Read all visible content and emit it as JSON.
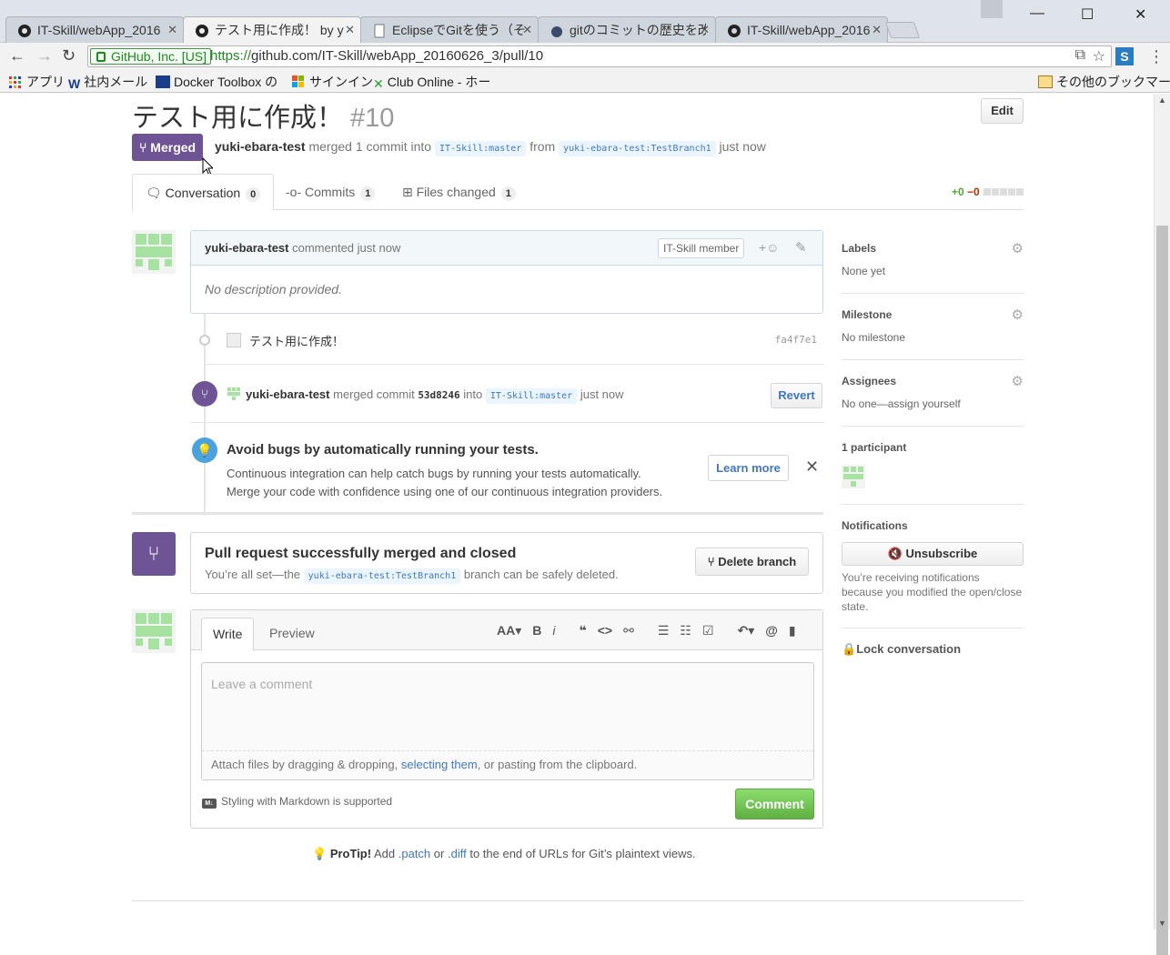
{
  "browser": {
    "tabs": [
      {
        "label": "IT-Skill/webApp_2016",
        "favicon": "github-icon"
      },
      {
        "label": "テスト用に作成！ by y",
        "favicon": "github-icon"
      },
      {
        "label": "EclipseでGitを使う（そ",
        "favicon": "page-icon"
      },
      {
        "label": "gitのコミットの歴史を改",
        "favicon": "site-icon"
      },
      {
        "label": "IT-Skill/webApp_2016",
        "favicon": "github-icon"
      }
    ],
    "secure_label": "GitHub, Inc. [US]",
    "url_protocol": "https://",
    "url_rest": "github.com/IT-Skill/webApp_20160626_3/pull/10",
    "bookmarks": [
      {
        "label": "アプリ"
      },
      {
        "label": "社内メール"
      },
      {
        "label": "Docker Toolbox の"
      },
      {
        "label": "サインイン"
      },
      {
        "label": "Club Online - ホー"
      }
    ],
    "other_bookmarks": "その他のブックマーク"
  },
  "pr": {
    "title": "テスト用に作成！",
    "number": "#10",
    "edit_label": "Edit",
    "state_label": "Merged",
    "author": "yuki-ebara-test",
    "merged_text": "merged 1 commit into",
    "base_ref": "IT-Skill:master",
    "from_text": "from",
    "head_ref": "yuki-ebara-test:TestBranch1",
    "time": "just now"
  },
  "tabs": [
    {
      "label": "Conversation",
      "count": "0"
    },
    {
      "label": "Commits",
      "count": "1"
    },
    {
      "label": "Files changed",
      "count": "1"
    }
  ],
  "diffstat": {
    "add": "+0",
    "del": "−0"
  },
  "comment": {
    "author": "yuki-ebara-test",
    "action": "commented just now",
    "badge": "IT-Skill member",
    "body": "No description provided."
  },
  "commit": {
    "message": "テスト用に作成！",
    "sha": "fa4f7e1"
  },
  "merge_event": {
    "author": "yuki-ebara-test",
    "text": "merged commit",
    "sha": "53d8246",
    "into": "into",
    "ref": "IT-Skill:master",
    "time": "just now",
    "revert_label": "Revert"
  },
  "ci": {
    "title": "Avoid bugs by automatically running your tests.",
    "line1": "Continuous integration can help catch bugs by running your tests automatically.",
    "line2": "Merge your code with confidence using one of our continuous integration providers.",
    "learn_more": "Learn more"
  },
  "merged_box": {
    "title": "Pull request successfully merged and closed",
    "prefix": "You’re all set—the",
    "ref": "yuki-ebara-test:TestBranch1",
    "suffix": "branch can be safely deleted.",
    "delete_label": "Delete branch"
  },
  "form": {
    "write_tab": "Write",
    "preview_tab": "Preview",
    "placeholder": "Leave a comment",
    "attach_prefix": "Attach files by dragging & dropping,",
    "attach_link": "selecting them",
    "attach_suffix": ", or pasting from the clipboard.",
    "markdown_note": "Styling with Markdown is supported",
    "comment_button": "Comment"
  },
  "protip": {
    "label": "ProTip!",
    "text1": "Add",
    "patch": ".patch",
    "text2": "or",
    "diff": ".diff",
    "text3": "to the end of URLs for Git’s plaintext views."
  },
  "sidebar": {
    "labels_head": "Labels",
    "labels_val": "None yet",
    "milestone_head": "Milestone",
    "milestone_val": "No milestone",
    "assignees_head": "Assignees",
    "assignees_val": "No one—assign yourself",
    "participants_head": "1 participant",
    "notifications_head": "Notifications",
    "unsubscribe": "Unsubscribe",
    "notif_desc": "You’re receiving notifications because you modified the open/close state.",
    "lock": "Lock conversation"
  },
  "colors": {
    "merged_purple": "#6e5494",
    "link_blue": "#4078c0",
    "green": "#60b044"
  }
}
